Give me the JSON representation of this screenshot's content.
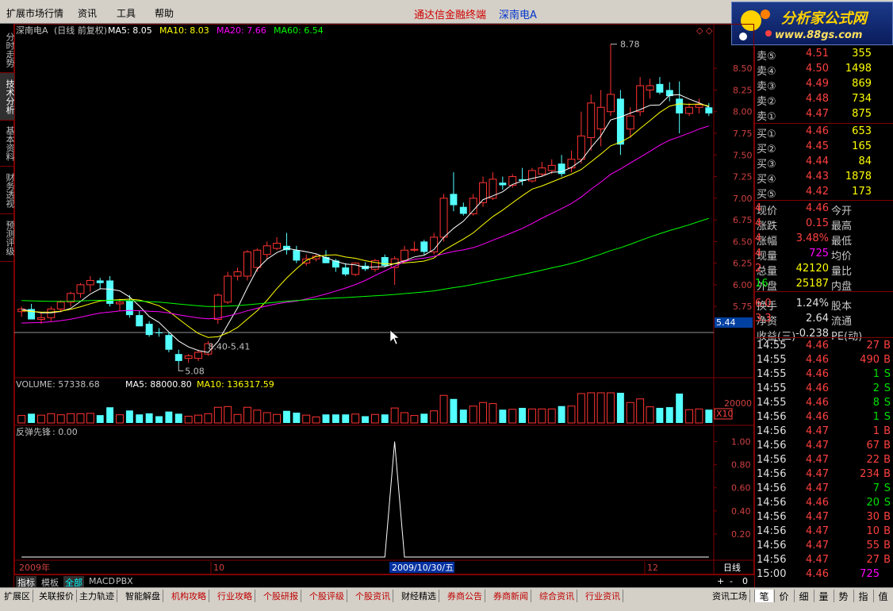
{
  "menu": {
    "items": [
      "扩展市场行情",
      "资讯",
      "工具",
      "帮助"
    ],
    "title": "通达信金融终端",
    "stock": "深南电A"
  },
  "logo": {
    "text": "分析家公式网",
    "url": "www.88gs.com"
  },
  "left_tabs": [
    "分时走势",
    "技术分析",
    "基本资料",
    "财务透视",
    "预测评级"
  ],
  "chart_data": [
    {
      "type": "candlestick",
      "title": "深南电A",
      "subtitle": "(日线 前复权)",
      "indicators": [
        {
          "name": "MA5",
          "value": "8.05",
          "color": "#ffffff"
        },
        {
          "name": "MA10",
          "value": "8.03",
          "color": "#ffff00"
        },
        {
          "name": "MA20",
          "value": "7.66",
          "color": "#ff00ff"
        },
        {
          "name": "MA60",
          "value": "6.54",
          "color": "#00ff00"
        }
      ],
      "ylim": [
        5.44,
        8.85
      ],
      "y_ticks": [
        "8.50",
        "8.25",
        "8.00",
        "7.75",
        "7.50",
        "7.25",
        "7.00",
        "6.75",
        "6.50",
        "6.25",
        "6.00",
        "5.75"
      ],
      "price_marker": "5.44",
      "annotations": {
        "high": "8.78",
        "low": "5.08",
        "range": "8.40-5.41"
      },
      "x_labels": [
        "2009年",
        "10",
        "12"
      ],
      "x_cursor": "2009/10/30/五",
      "period": "日线",
      "candles": [
        [
          5.69,
          5.75,
          5.63,
          5.72
        ],
        [
          5.72,
          5.78,
          5.61,
          5.6
        ],
        [
          5.6,
          5.68,
          5.55,
          5.62
        ],
        [
          5.62,
          5.75,
          5.58,
          5.72
        ],
        [
          5.72,
          5.82,
          5.68,
          5.8
        ],
        [
          5.8,
          5.92,
          5.75,
          5.9
        ],
        [
          5.9,
          6.02,
          5.85,
          6.0
        ],
        [
          6.0,
          6.1,
          5.92,
          6.05
        ],
        [
          6.05,
          6.08,
          5.95,
          6.02
        ],
        [
          6.05,
          6.1,
          5.75,
          5.78
        ],
        [
          5.78,
          5.84,
          5.7,
          5.8
        ],
        [
          5.82,
          5.88,
          5.62,
          5.65
        ],
        [
          5.65,
          5.7,
          5.55,
          5.52
        ],
        [
          5.55,
          5.58,
          5.4,
          5.42
        ],
        [
          5.45,
          5.5,
          5.4,
          5.44
        ],
        [
          5.42,
          5.45,
          5.22,
          5.25
        ],
        [
          5.2,
          5.25,
          5.08,
          5.12
        ],
        [
          5.15,
          5.2,
          5.1,
          5.18
        ],
        [
          5.15,
          5.25,
          5.12,
          5.22
        ],
        [
          5.2,
          5.35,
          5.18,
          5.32
        ],
        [
          5.6,
          5.9,
          5.55,
          5.88
        ],
        [
          5.8,
          6.15,
          5.78,
          6.1
        ],
        [
          6.1,
          6.2,
          6.05,
          6.15
        ],
        [
          6.1,
          6.4,
          6.05,
          6.38
        ],
        [
          6.2,
          6.42,
          6.15,
          6.4
        ],
        [
          6.35,
          6.5,
          6.3,
          6.45
        ],
        [
          6.42,
          6.55,
          6.4,
          6.48
        ],
        [
          6.45,
          6.6,
          6.35,
          6.4
        ],
        [
          6.4,
          6.45,
          6.25,
          6.28
        ],
        [
          6.25,
          6.35,
          6.22,
          6.3
        ],
        [
          6.3,
          6.35,
          6.27,
          6.33
        ],
        [
          6.32,
          6.4,
          6.25,
          6.25
        ],
        [
          6.28,
          6.3,
          6.15,
          6.2
        ],
        [
          6.2,
          6.25,
          6.1,
          6.12
        ],
        [
          6.12,
          6.26,
          6.1,
          6.25
        ],
        [
          6.22,
          6.26,
          6.16,
          6.18
        ],
        [
          6.18,
          6.3,
          6.15,
          6.28
        ],
        [
          6.32,
          6.35,
          6.2,
          6.22
        ],
        [
          6.2,
          6.33,
          6.0,
          6.3
        ],
        [
          6.28,
          6.45,
          6.25,
          6.4
        ],
        [
          6.4,
          6.5,
          6.38,
          6.41
        ],
        [
          6.5,
          6.52,
          6.35,
          6.38
        ],
        [
          6.38,
          6.6,
          6.35,
          6.55
        ],
        [
          6.55,
          7.05,
          6.5,
          7.0
        ],
        [
          7.05,
          7.3,
          6.85,
          6.92
        ],
        [
          6.9,
          6.95,
          6.8,
          6.82
        ],
        [
          6.82,
          7.05,
          6.8,
          7.0
        ],
        [
          6.95,
          7.25,
          6.9,
          7.18
        ],
        [
          7.0,
          7.3,
          6.98,
          7.22
        ],
        [
          7.18,
          7.25,
          7.1,
          7.15
        ],
        [
          7.15,
          7.28,
          7.12,
          7.25
        ],
        [
          7.22,
          7.35,
          7.15,
          7.2
        ],
        [
          7.2,
          7.35,
          7.18,
          7.32
        ],
        [
          7.28,
          7.42,
          7.25,
          7.35
        ],
        [
          7.32,
          7.45,
          7.28,
          7.38
        ],
        [
          7.4,
          7.5,
          7.25,
          7.28
        ],
        [
          7.35,
          7.55,
          7.3,
          7.45
        ],
        [
          7.45,
          8.0,
          7.4,
          7.72
        ],
        [
          7.7,
          8.2,
          7.55,
          8.1
        ],
        [
          7.8,
          8.25,
          7.6,
          8.05
        ],
        [
          8.0,
          8.78,
          7.95,
          8.2
        ],
        [
          8.15,
          8.25,
          7.5,
          7.62
        ],
        [
          7.8,
          8.05,
          7.7,
          7.95
        ],
        [
          8.0,
          8.4,
          7.95,
          8.3
        ],
        [
          8.25,
          8.38,
          8.15,
          8.3
        ],
        [
          8.32,
          8.4,
          8.2,
          8.22
        ],
        [
          8.25,
          8.34,
          8.12,
          8.18
        ],
        [
          8.15,
          8.35,
          7.75,
          7.98
        ],
        [
          7.98,
          8.1,
          7.95,
          8.05
        ],
        [
          8.05,
          8.15,
          7.98,
          8.08
        ],
        [
          8.05,
          8.1,
          7.95,
          7.98
        ]
      ]
    },
    {
      "type": "bar",
      "title": "VOLUME: 57338.68",
      "indicators": [
        {
          "name": "MA5",
          "value": "88000.80",
          "color": "#ffffff"
        },
        {
          "name": "MA10",
          "value": "136317.59",
          "color": "#ffff00"
        }
      ],
      "y_ticks": [
        "20000"
      ],
      "multiplier": "X10"
    },
    {
      "type": "line",
      "title": "反弹先锋",
      "value": "0.00",
      "ylim": [
        0,
        1.1
      ],
      "y_ticks": [
        "1.00",
        "0.80",
        "0.60",
        "0.40",
        "0.20"
      ],
      "signal_index": 38,
      "signal_value": 1.0
    }
  ],
  "quote": {
    "sell": [
      [
        "卖⑤",
        "4.51",
        "355"
      ],
      [
        "卖④",
        "4.50",
        "1498"
      ],
      [
        "卖③",
        "4.49",
        "869"
      ],
      [
        "卖②",
        "4.48",
        "734"
      ],
      [
        "卖①",
        "4.47",
        "875"
      ]
    ],
    "buy": [
      [
        "买①",
        "4.46",
        "653"
      ],
      [
        "买②",
        "4.45",
        "165"
      ],
      [
        "买③",
        "4.44",
        "84"
      ],
      [
        "买④",
        "4.43",
        "1878"
      ],
      [
        "买⑤",
        "4.42",
        "173"
      ]
    ],
    "stats": [
      [
        "现价",
        "4.46",
        "今开",
        "4"
      ],
      [
        "涨跌",
        "0.15",
        "最高",
        "4"
      ],
      [
        "涨幅",
        "3.48%",
        "最低",
        "4"
      ],
      [
        "现量",
        "725",
        "均价",
        "4"
      ],
      [
        "总量",
        "42120",
        "量比",
        "2"
      ],
      [
        "外盘",
        "25187",
        "内盘",
        "16"
      ],
      [
        "换手",
        "1.24%",
        "股本",
        "6.0"
      ],
      [
        "净资",
        "2.64",
        "流通",
        "3.3"
      ],
      [
        "收益(三)",
        "-0.238",
        "PE(动)",
        ""
      ]
    ],
    "ticks": [
      [
        "14:55",
        "4.46",
        "27",
        "B"
      ],
      [
        "14:55",
        "4.46",
        "490",
        "B"
      ],
      [
        "14:55",
        "4.46",
        "1",
        "S"
      ],
      [
        "14:55",
        "4.46",
        "2",
        "S"
      ],
      [
        "14:55",
        "4.46",
        "8",
        "S"
      ],
      [
        "14:56",
        "4.46",
        "1",
        "S"
      ],
      [
        "14:56",
        "4.47",
        "1",
        "B"
      ],
      [
        "14:56",
        "4.47",
        "67",
        "B"
      ],
      [
        "14:56",
        "4.47",
        "22",
        "B"
      ],
      [
        "14:56",
        "4.47",
        "234",
        "B"
      ],
      [
        "14:56",
        "4.47",
        "7",
        "S"
      ],
      [
        "14:56",
        "4.46",
        "20",
        "S"
      ],
      [
        "14:56",
        "4.47",
        "30",
        "B"
      ],
      [
        "14:56",
        "4.47",
        "10",
        "B"
      ],
      [
        "14:56",
        "4.47",
        "55",
        "B"
      ],
      [
        "14:56",
        "4.47",
        "27",
        "B"
      ],
      [
        "15:00",
        "4.46",
        "725",
        ""
      ]
    ]
  },
  "bottom_tabs": [
    "指标",
    "模板",
    "全部",
    "MACD",
    "PBX"
  ],
  "bottom_controls": [
    "+",
    "-",
    "0"
  ],
  "status_tabs": [
    "扩展区",
    "关联报价",
    "主力轨迹",
    "智能解盘",
    "机构攻略",
    "行业攻略",
    "个股研报",
    "个股评级",
    "个股资讯",
    "财经精选",
    "券商公告",
    "券商新闻",
    "综合资讯",
    "行业资讯"
  ],
  "status_right": "资讯工场",
  "right_tabs": [
    "笔",
    "价",
    "细",
    "量",
    "势",
    "指",
    "值"
  ]
}
